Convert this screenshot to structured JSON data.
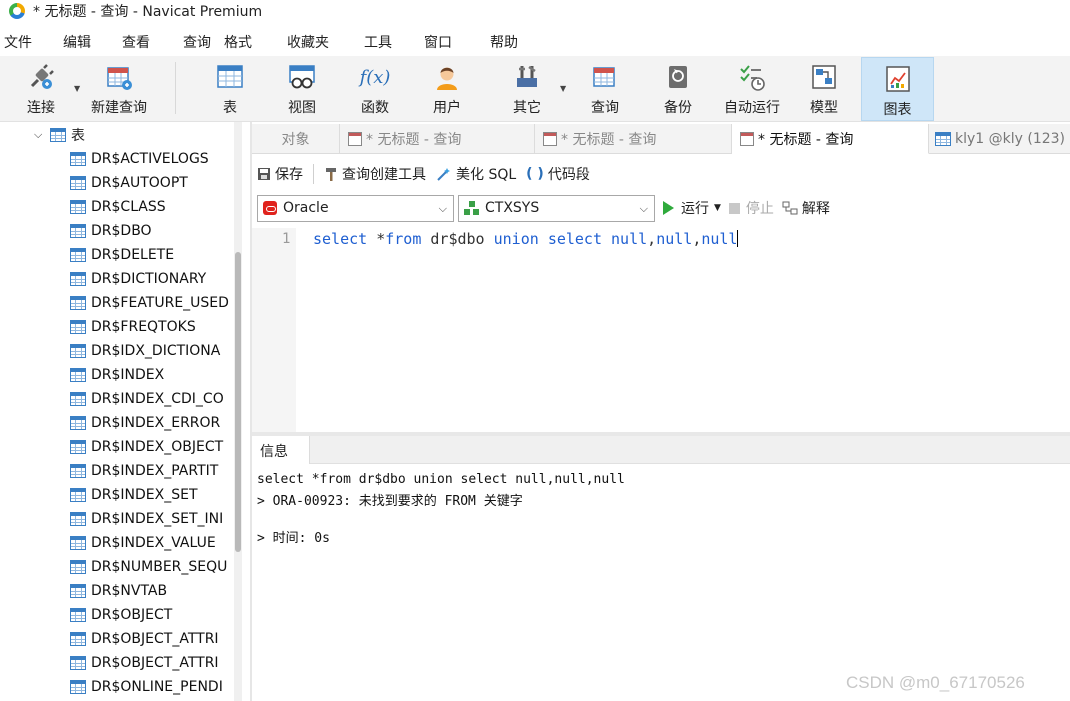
{
  "window": {
    "title": "* 无标题 - 查询 - Navicat Premium"
  },
  "menu": [
    "文件",
    "编辑",
    "查看",
    "查询",
    "格式",
    "收藏夹",
    "工具",
    "窗口",
    "帮助"
  ],
  "toolbar": {
    "connect": "连接",
    "new_query": "新建查询",
    "table": "表",
    "view": "视图",
    "function": "函数",
    "user": "用户",
    "other": "其它",
    "query": "查询",
    "backup": "备份",
    "autorun": "自动运行",
    "model": "模型",
    "chart": "图表",
    "function_glyph": "f(x)"
  },
  "sidebar": {
    "root_label": "表",
    "items": [
      "DR$ACTIVELOGS",
      "DR$AUTOOPT",
      "DR$CLASS",
      "DR$DBO",
      "DR$DELETE",
      "DR$DICTIONARY",
      "DR$FEATURE_USED",
      "DR$FREQTOKS",
      "DR$IDX_DICTIONA",
      "DR$INDEX",
      "DR$INDEX_CDI_CO",
      "DR$INDEX_ERROR",
      "DR$INDEX_OBJECT",
      "DR$INDEX_PARTIT",
      "DR$INDEX_SET",
      "DR$INDEX_SET_INI",
      "DR$INDEX_VALUE",
      "DR$NUMBER_SEQU",
      "DR$NVTAB",
      "DR$OBJECT",
      "DR$OBJECT_ATTRI",
      "DR$OBJECT_ATTRI",
      "DR$ONLINE_PENDI"
    ]
  },
  "tabs": [
    "对象",
    "* 无标题 - 查询",
    "* 无标题 - 查询",
    "* 无标题 - 查询",
    "kly1 @kly (123) -"
  ],
  "query_toolbar": {
    "save": "保存",
    "builder": "查询创建工具",
    "beautify": "美化 SQL",
    "snippet": "代码段"
  },
  "selectors": {
    "connection": "Oracle",
    "schema": "CTXSYS",
    "run": "运行",
    "stop": "停止",
    "explain": "解释"
  },
  "editor": {
    "line_number": "1",
    "tokens": [
      {
        "t": "select",
        "c": "kw"
      },
      {
        "t": " *",
        "c": "tx"
      },
      {
        "t": "from",
        "c": "kw"
      },
      {
        "t": " dr$dbo ",
        "c": "tx"
      },
      {
        "t": "union",
        "c": "kw"
      },
      {
        "t": " ",
        "c": "tx"
      },
      {
        "t": "select",
        "c": "kw"
      },
      {
        "t": " ",
        "c": "tx"
      },
      {
        "t": "null",
        "c": "kw"
      },
      {
        "t": ",",
        "c": "tx"
      },
      {
        "t": "null",
        "c": "kw"
      },
      {
        "t": ",",
        "c": "tx"
      },
      {
        "t": "null",
        "c": "kw"
      }
    ]
  },
  "info": {
    "tab": "信息",
    "lines": [
      "select *from dr$dbo union select null,null,null",
      "> ORA-00923: 未找到要求的 FROM 关键字",
      "> 时间: 0s"
    ]
  },
  "watermark": "CSDN @m0_67170526",
  "colors": {
    "keyword": "#1f5fd1",
    "active_tool_bg": "#cfe6f8",
    "run_green": "#2faa3c",
    "oracle_red": "#e0231d"
  }
}
